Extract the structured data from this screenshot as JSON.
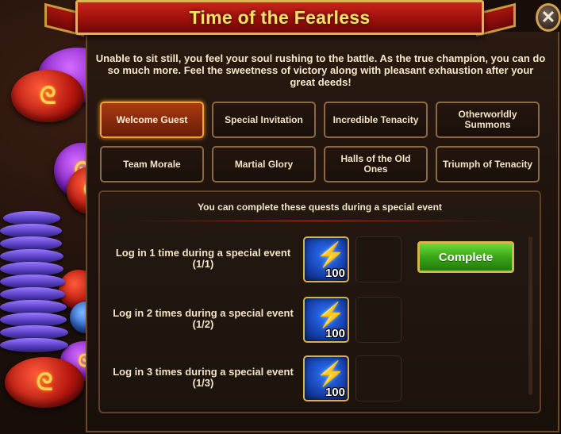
{
  "title": "Time of the Fearless",
  "close_label": "✕",
  "intro_text": "Unable to sit still, you feel your soul rushing to the battle. As the true champion, you can do so much more. Feel the sweetness of victory along with pleasant exhaustion after your great deeds!",
  "tabs": [
    {
      "label": "Welcome Guest",
      "active": true
    },
    {
      "label": "Special Invitation",
      "active": false
    },
    {
      "label": "Incredible Tenacity",
      "active": false
    },
    {
      "label": "Otherworldly Summons",
      "active": false
    },
    {
      "label": "Team Morale",
      "active": false
    },
    {
      "label": "Martial Glory",
      "active": false
    },
    {
      "label": "Halls of the Old Ones",
      "active": false
    },
    {
      "label": "Triumph of Tenacity",
      "active": false
    }
  ],
  "quests": {
    "header": "You can complete these quests during a special event",
    "items": [
      {
        "text": "Log in 1 time during a special event",
        "progress": "(1/1)",
        "reward_icon": "energy-bolt-icon",
        "reward_amount": "100",
        "button": "Complete"
      },
      {
        "text": "Log in 2 times during a special event",
        "progress": "(1/2)",
        "reward_icon": "energy-bolt-icon",
        "reward_amount": "100",
        "button": ""
      },
      {
        "text": "Log in 3 times during a special event",
        "progress": "(1/3)",
        "reward_icon": "energy-bolt-icon",
        "reward_amount": "100",
        "button": ""
      }
    ]
  },
  "colors": {
    "ribbon": "#b01a13",
    "accent_gold": "#e1b24d",
    "active_tab": "#a83a12",
    "complete_button": "#3aa518"
  }
}
